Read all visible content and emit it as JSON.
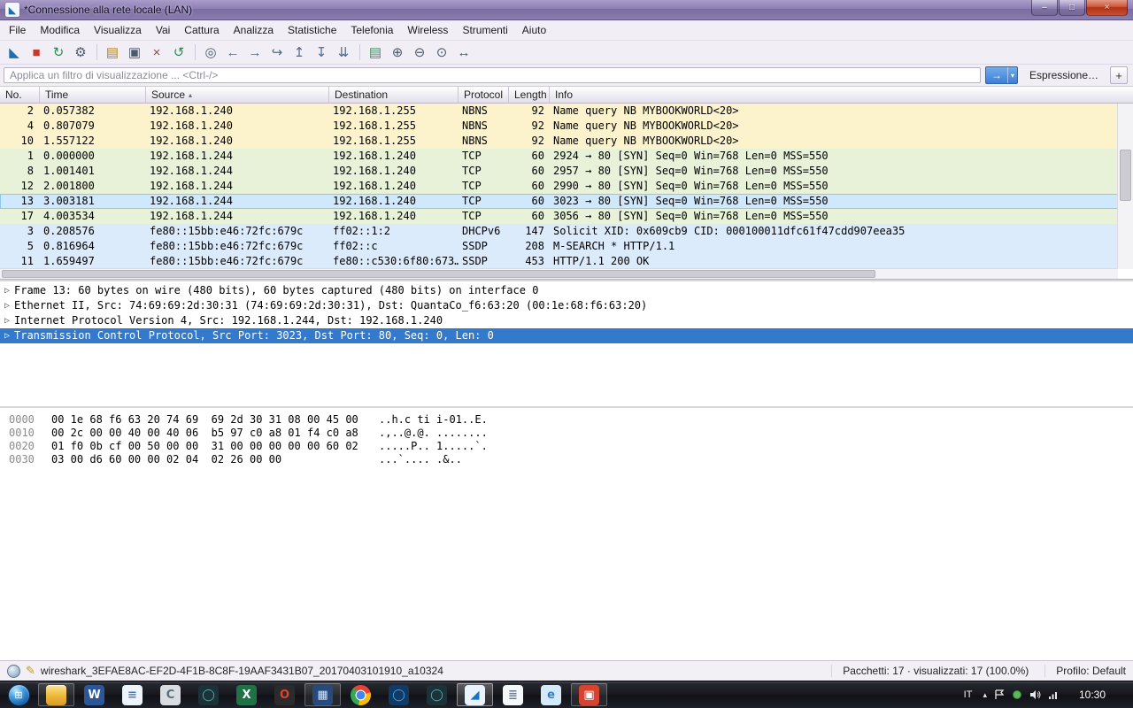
{
  "window": {
    "title": "*Connessione alla rete locale (LAN)"
  },
  "window_controls": {
    "minimize": "–",
    "maximize": "□",
    "close": "×"
  },
  "menu": {
    "items": [
      "File",
      "Modifica",
      "Visualizza",
      "Vai",
      "Cattura",
      "Analizza",
      "Statistiche",
      "Telefonia",
      "Wireless",
      "Strumenti",
      "Aiuto"
    ]
  },
  "toolbar": {
    "icons": [
      {
        "name": "start-capture-icon",
        "glyph": "◣",
        "color": "#1f6fb0",
        "sep": ""
      },
      {
        "name": "stop-capture-icon",
        "glyph": "■",
        "color": "#c23b2e",
        "sep": ""
      },
      {
        "name": "restart-capture-icon",
        "glyph": "↻",
        "color": "#2e8b57",
        "sep": ""
      },
      {
        "name": "capture-options-icon",
        "glyph": "⚙",
        "color": "#4a5a6a",
        "sep": ""
      },
      {
        "name": "open-file-icon",
        "glyph": "▤",
        "color": "#b8860b",
        "sep": "sep-before"
      },
      {
        "name": "save-file-icon",
        "glyph": "▣",
        "color": "#4a5a6a",
        "sep": ""
      },
      {
        "name": "close-file-icon",
        "glyph": "×",
        "color": "#8a4a4a",
        "sep": ""
      },
      {
        "name": "reload-file-icon",
        "glyph": "↺",
        "color": "#2e8b57",
        "sep": ""
      },
      {
        "name": "find-packet-icon",
        "glyph": "◎",
        "color": "#4a5a6a",
        "sep": "sep-before"
      },
      {
        "name": "back-icon",
        "glyph": "←",
        "color": "#4a6b8a",
        "sep": ""
      },
      {
        "name": "forward-icon",
        "glyph": "→",
        "color": "#4a6b8a",
        "sep": ""
      },
      {
        "name": "goto-packet-icon",
        "glyph": "↪",
        "color": "#4a6b8a",
        "sep": ""
      },
      {
        "name": "first-packet-icon",
        "glyph": "↥",
        "color": "#4a6b8a",
        "sep": ""
      },
      {
        "name": "last-packet-icon",
        "glyph": "↧",
        "color": "#4a6b8a",
        "sep": ""
      },
      {
        "name": "autoscroll-icon",
        "glyph": "⇊",
        "color": "#4a6b8a",
        "sep": ""
      },
      {
        "name": "colorize-icon",
        "glyph": "▤",
        "color": "#3f8f5f",
        "sep": "sep-before"
      },
      {
        "name": "zoom-in-icon",
        "glyph": "⊕",
        "color": "#4a5a6a",
        "sep": ""
      },
      {
        "name": "zoom-out-icon",
        "glyph": "⊖",
        "color": "#4a5a6a",
        "sep": ""
      },
      {
        "name": "zoom-100-icon",
        "glyph": "⊙",
        "color": "#4a5a6a",
        "sep": ""
      },
      {
        "name": "resize-columns-icon",
        "glyph": "↔",
        "color": "#4a5a6a",
        "sep": ""
      }
    ]
  },
  "filter": {
    "placeholder": "Applica un filtro di visualizzazione ... <Ctrl-/>",
    "apply_glyph": "→",
    "caret": "▾",
    "expression_label": "Espressione…",
    "add_label": "+"
  },
  "packet_list": {
    "columns": [
      {
        "label": "No.",
        "key": "no",
        "name": "column-header-no",
        "sort": ""
      },
      {
        "label": "Time",
        "key": "time",
        "name": "column-header-time",
        "sort": ""
      },
      {
        "label": "Source",
        "key": "source",
        "name": "column-header-source",
        "sort": "▴"
      },
      {
        "label": "Destination",
        "key": "destination",
        "name": "column-header-destination",
        "sort": ""
      },
      {
        "label": "Protocol",
        "key": "protocol",
        "name": "column-header-protocol",
        "sort": ""
      },
      {
        "label": "Length",
        "key": "length",
        "name": "column-header-length",
        "sort": ""
      },
      {
        "label": "Info",
        "key": "info",
        "name": "column-header-info",
        "sort": ""
      }
    ],
    "rows": [
      {
        "no": "2",
        "time": "0.057382",
        "source": "192.168.1.240",
        "destination": "192.168.1.255",
        "protocol": "NBNS",
        "length": "92",
        "info": "Name query NB MYBOOKWORLD<20>",
        "variant": "nbns"
      },
      {
        "no": "4",
        "time": "0.807079",
        "source": "192.168.1.240",
        "destination": "192.168.1.255",
        "protocol": "NBNS",
        "length": "92",
        "info": "Name query NB MYBOOKWORLD<20>",
        "variant": "nbns"
      },
      {
        "no": "10",
        "time": "1.557122",
        "source": "192.168.1.240",
        "destination": "192.168.1.255",
        "protocol": "NBNS",
        "length": "92",
        "info": "Name query NB MYBOOKWORLD<20>",
        "variant": "nbns"
      },
      {
        "no": "1",
        "time": "0.000000",
        "source": "192.168.1.244",
        "destination": "192.168.1.240",
        "protocol": "TCP",
        "length": "60",
        "info": "2924 → 80 [SYN] Seq=0 Win=768 Len=0 MSS=550",
        "variant": "tcp"
      },
      {
        "no": "8",
        "time": "1.001401",
        "source": "192.168.1.244",
        "destination": "192.168.1.240",
        "protocol": "TCP",
        "length": "60",
        "info": "2957 → 80 [SYN] Seq=0 Win=768 Len=0 MSS=550",
        "variant": "tcp"
      },
      {
        "no": "12",
        "time": "2.001800",
        "source": "192.168.1.244",
        "destination": "192.168.1.240",
        "protocol": "TCP",
        "length": "60",
        "info": "2990 → 80 [SYN] Seq=0 Win=768 Len=0 MSS=550",
        "variant": "tcp"
      },
      {
        "no": "13",
        "time": "3.003181",
        "source": "192.168.1.244",
        "destination": "192.168.1.240",
        "protocol": "TCP",
        "length": "60",
        "info": "3023 → 80 [SYN] Seq=0 Win=768 Len=0 MSS=550",
        "variant": "selected"
      },
      {
        "no": "17",
        "time": "4.003534",
        "source": "192.168.1.244",
        "destination": "192.168.1.240",
        "protocol": "TCP",
        "length": "60",
        "info": "3056 → 80 [SYN] Seq=0 Win=768 Len=0 MSS=550",
        "variant": "tcp"
      },
      {
        "no": "3",
        "time": "0.208576",
        "source": "fe80::15bb:e46:72fc:679c",
        "destination": "ff02::1:2",
        "protocol": "DHCPv6",
        "length": "147",
        "info": "Solicit XID: 0x609cb9 CID: 000100011dfc61f47cdd907eea35",
        "variant": "ipv6"
      },
      {
        "no": "5",
        "time": "0.816964",
        "source": "fe80::15bb:e46:72fc:679c",
        "destination": "ff02::c",
        "protocol": "SSDP",
        "length": "208",
        "info": "M-SEARCH * HTTP/1.1",
        "variant": "ipv6"
      },
      {
        "no": "11",
        "time": "1.659497",
        "source": "fe80::15bb:e46:72fc:679c",
        "destination": "fe80::c530:6f80:673…",
        "protocol": "SSDP",
        "length": "453",
        "info": "HTTP/1.1 200 OK",
        "variant": "ipv6"
      }
    ]
  },
  "details": {
    "expander": "▷",
    "rows": [
      {
        "text": "Frame 13: 60 bytes on wire (480 bits), 60 bytes captured (480 bits) on interface 0",
        "variant": ""
      },
      {
        "text": "Ethernet II, Src: 74:69:69:2d:30:31 (74:69:69:2d:30:31), Dst: QuantaCo_f6:63:20 (00:1e:68:f6:63:20)",
        "variant": ""
      },
      {
        "text": "Internet Protocol Version 4, Src: 192.168.1.244, Dst: 192.168.1.240",
        "variant": ""
      },
      {
        "text": "Transmission Control Protocol, Src Port: 3023, Dst Port: 80, Seq: 0, Len: 0",
        "variant": "selected"
      }
    ]
  },
  "hex": {
    "lines": [
      {
        "offset": "0000",
        "hex": "00 1e 68 f6 63 20 74 69  69 2d 30 31 08 00 45 00",
        "ascii": "..h.c ti i-01..E."
      },
      {
        "offset": "0010",
        "hex": "00 2c 00 00 40 00 40 06  b5 97 c0 a8 01 f4 c0 a8",
        "ascii": ".,..@.@. ........"
      },
      {
        "offset": "0020",
        "hex": "01 f0 0b cf 00 50 00 00  31 00 00 00 00 00 60 02",
        "ascii": ".....P.. 1.....`."
      },
      {
        "offset": "0030",
        "hex": "03 00 d6 60 00 00 02 04  02 26 00 00",
        "ascii": "...`.... .&.."
      }
    ]
  },
  "status": {
    "pencil_glyph": "✎",
    "capture_file": "wireshark_3EFAE8AC-EF2D-4F1B-8C8F-19AAF3431B07_20170403101910_a10324",
    "packets": "Pacchetti: 17 · visualizzati: 17 (100.0%)",
    "profile": "Profilo: Default"
  },
  "taskbar": {
    "start_glyph": "⊞",
    "apps": [
      {
        "name": "taskbar-explorer-button",
        "icon_name": "explorer-folder-icon",
        "glyph": "",
        "kind": "folder",
        "state": "running"
      },
      {
        "name": "taskbar-word-button",
        "icon_name": "word-icon",
        "glyph": "W",
        "bg": "#2b579a",
        "fg": "#ffffff",
        "kind": "",
        "state": ""
      },
      {
        "name": "taskbar-wordpad-button",
        "icon_name": "document-icon",
        "glyph": "≡",
        "bg": "#eef4fb",
        "fg": "#4d7ab0",
        "kind": "",
        "state": ""
      },
      {
        "name": "taskbar-gray-app-button",
        "icon_name": "gray-app-icon",
        "glyph": "C",
        "bg": "#d9dde2",
        "fg": "#5a6b7a",
        "kind": "",
        "state": ""
      },
      {
        "name": "taskbar-teal-app-button",
        "icon_name": "teal-ring-icon",
        "glyph": "◯",
        "bg": "#1d3138",
        "fg": "#35c4b5",
        "kind": "",
        "state": ""
      },
      {
        "name": "taskbar-excel-button",
        "icon_name": "excel-icon",
        "glyph": "X",
        "bg": "#1f7246",
        "fg": "#ffffff",
        "kind": "",
        "state": ""
      },
      {
        "name": "taskbar-opera-button",
        "icon_name": "orange-ring-icon",
        "glyph": "O",
        "bg": "#2b2b2b",
        "fg": "#e6402e",
        "kind": "",
        "state": ""
      },
      {
        "name": "taskbar-grid-app-button",
        "icon_name": "grid-app-icon",
        "glyph": "▦",
        "bg": "#274a7c",
        "fg": "#cfe3ff",
        "kind": "",
        "state": "running"
      },
      {
        "name": "taskbar-chrome-button",
        "icon_name": "chrome-icon",
        "glyph": "",
        "kind": "chrome",
        "state": ""
      },
      {
        "name": "taskbar-blue-app-button",
        "icon_name": "blue-ring-icon",
        "glyph": "◯",
        "bg": "#123a66",
        "fg": "#4aa8e8",
        "kind": "",
        "state": ""
      },
      {
        "name": "taskbar-teal-app2-button",
        "icon_name": "teal-ring2-icon",
        "glyph": "◯",
        "bg": "#1d3138",
        "fg": "#35c4b5",
        "kind": "",
        "state": ""
      },
      {
        "name": "taskbar-wireshark-button",
        "icon_name": "wireshark-fin-icon",
        "glyph": "◢",
        "bg": "#eaf3fb",
        "fg": "#1b73be",
        "kind": "",
        "state": "active"
      },
      {
        "name": "taskbar-notepad-button",
        "icon_name": "notepad-icon",
        "glyph": "≣",
        "bg": "#f5f8fb",
        "fg": "#6b7d90",
        "kind": "",
        "state": ""
      },
      {
        "name": "taskbar-ie-button",
        "icon_name": "ie-icon",
        "glyph": "e",
        "bg": "#d4e9f9",
        "fg": "#2f7fd3",
        "kind": "",
        "state": ""
      },
      {
        "name": "taskbar-red-app-button",
        "icon_name": "red-app-icon",
        "glyph": "▣",
        "bg": "#d8432f",
        "fg": "#ffffff",
        "kind": "",
        "state": "running"
      }
    ],
    "tray": {
      "language": "IT",
      "chevron": "▴",
      "clock": "10:30"
    }
  }
}
